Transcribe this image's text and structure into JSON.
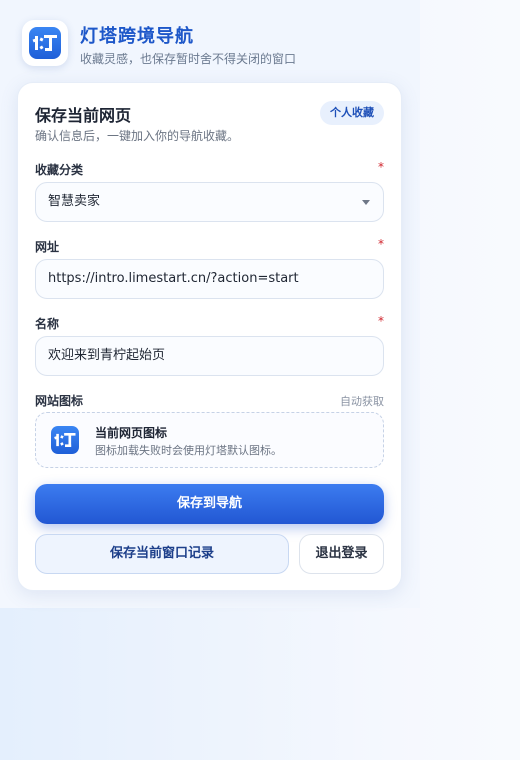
{
  "app": {
    "logo_glyph": "灯",
    "title": "灯塔跨境导航",
    "subtitle": "收藏灵感，也保存暂时舍不得关闭的窗口"
  },
  "form": {
    "title": "保存当前网页",
    "description": "确认信息后，一键加入你的导航收藏。",
    "badge": "个人收藏",
    "category": {
      "label": "收藏分类",
      "required_mark": "*",
      "selected_value": "智慧卖家"
    },
    "url": {
      "label": "网址",
      "required_mark": "*",
      "value": "https://intro.limestart.cn/?action=start"
    },
    "name": {
      "label": "名称",
      "required_mark": "*",
      "value": "欢迎来到青柠起始页"
    },
    "favicon": {
      "label": "网站图标",
      "hint": "自动获取",
      "title": "当前网页图标",
      "description": "图标加载失败时会使用灯塔默认图标。"
    },
    "buttons": {
      "save_to_nav": "保存到导航",
      "save_window": "保存当前窗口记录",
      "logout": "退出登录"
    }
  },
  "colors": {
    "brand": "#1d57c9",
    "primary_button": "#2f6ae4",
    "required": "#d0252d"
  },
  "icons": {
    "logo": "lighthouse-logo-icon",
    "dropdown": "chevron-down-icon",
    "favicon": "favicon-icon"
  }
}
